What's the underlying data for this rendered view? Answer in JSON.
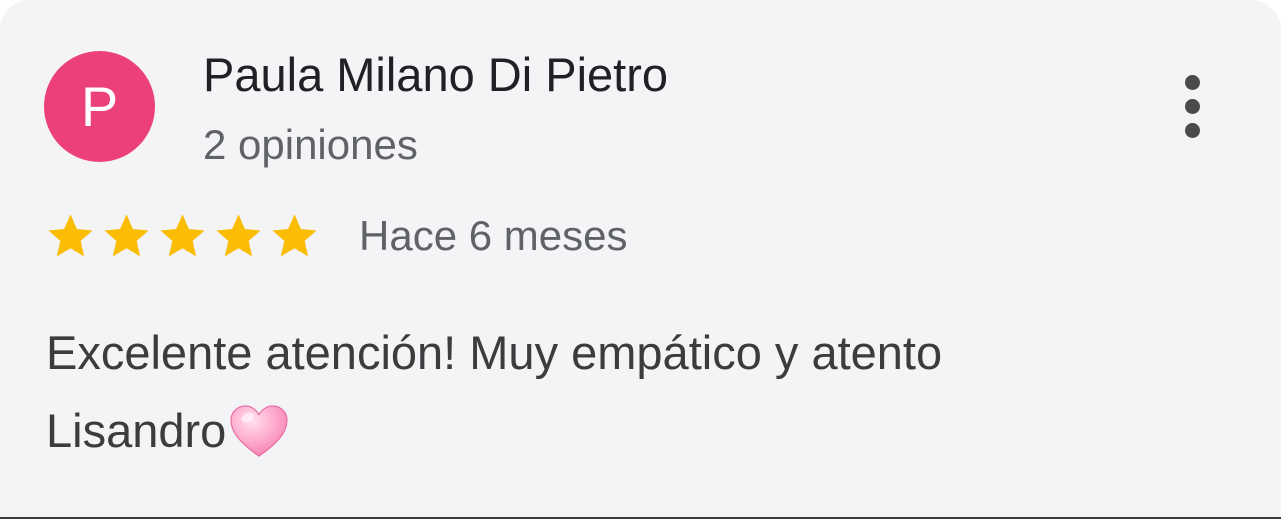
{
  "review": {
    "author": {
      "initial": "P",
      "avatar_color": "#ec407a",
      "name": "Paula Milano Di Pietro",
      "review_count_text": "2 opiniones"
    },
    "rating": 5,
    "rating_max": 5,
    "star_color": "#fbbc04",
    "date_text": "Hace 6 meses",
    "text_line_1": "Excelente atención! Muy empático y atento",
    "text_line_2": "Lisandro",
    "trailing_emoji": "pink-heart-icon",
    "menu_icon": "more-vert-icon"
  }
}
